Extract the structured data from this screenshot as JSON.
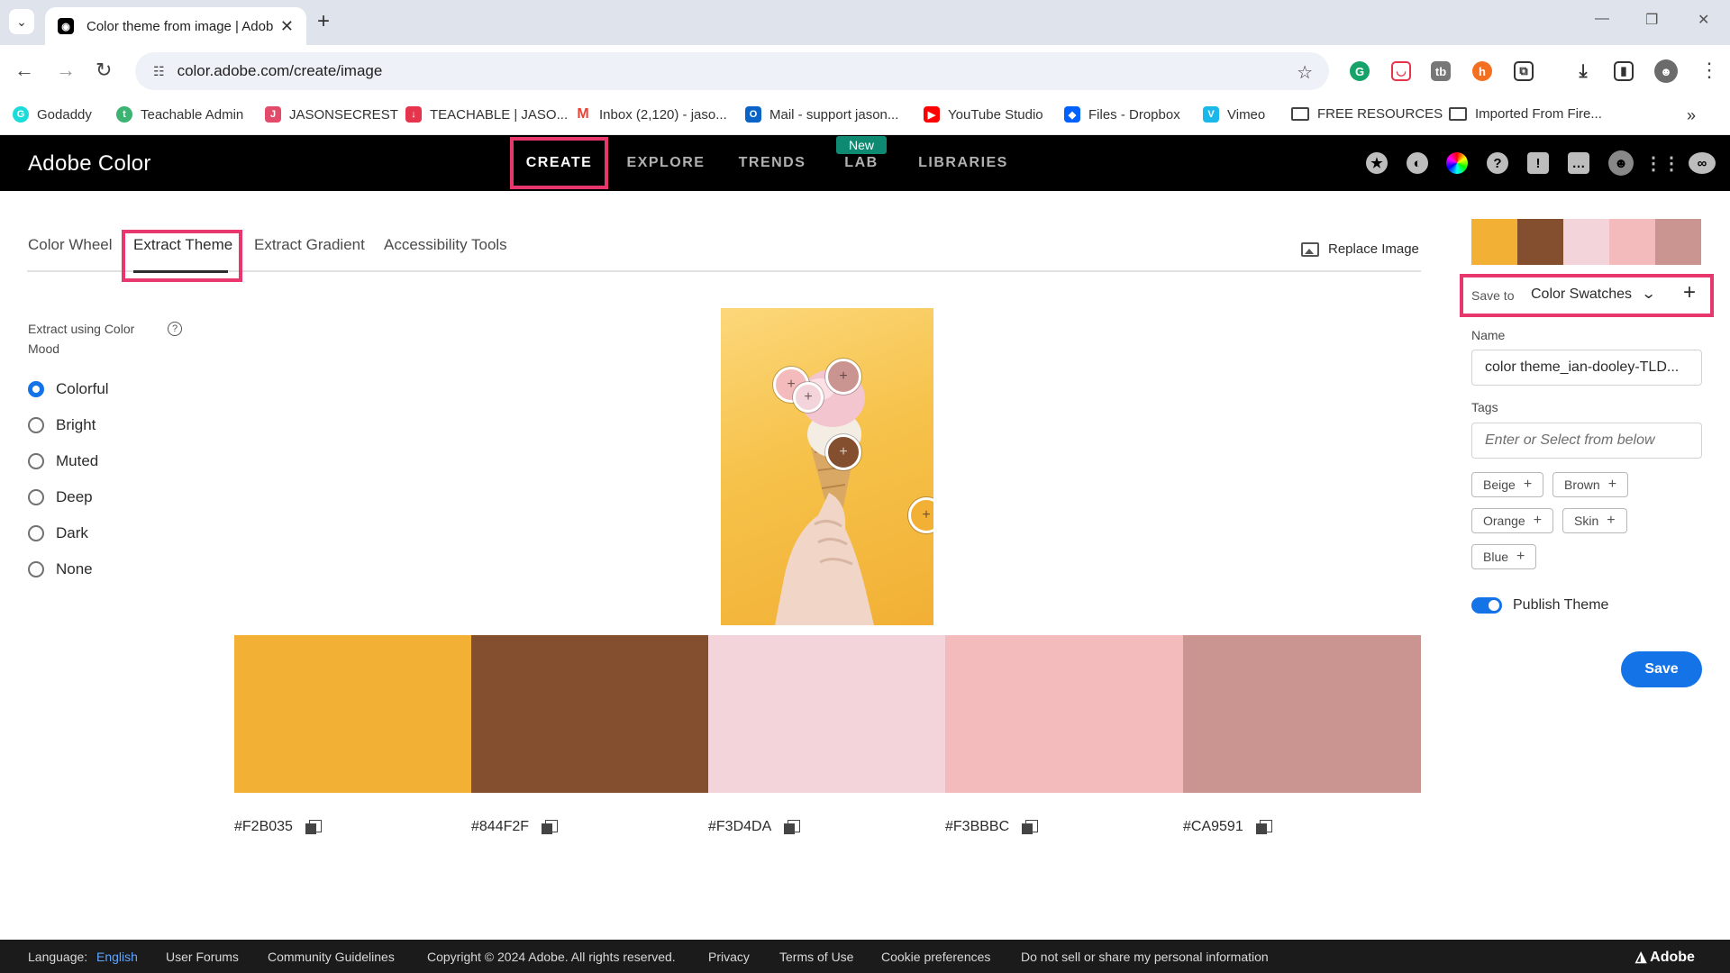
{
  "browser": {
    "tab_title": "Color theme from image | Adob",
    "url": "color.adobe.com/create/image",
    "bookmarks": [
      {
        "label": "Godaddy",
        "icon": "godaddy-icon",
        "color": "#1bdbdb"
      },
      {
        "label": "Teachable Admin",
        "icon": "teachable-icon",
        "color": "#3cb371"
      },
      {
        "label": "JASONSECREST",
        "icon": "jasonsecrest-icon",
        "color": "#e34b6a"
      },
      {
        "label": "TEACHABLE | JASO...",
        "icon": "download-icon",
        "color": "#e5344c"
      },
      {
        "label": "Inbox (2,120) - jaso...",
        "icon": "gmail-icon",
        "color": "#ea4335"
      },
      {
        "label": "Mail - support jason...",
        "icon": "outlook-icon",
        "color": "#0a64c8"
      },
      {
        "label": "YouTube Studio",
        "icon": "youtube-icon",
        "color": "#ff0000"
      },
      {
        "label": "Files - Dropbox",
        "icon": "dropbox-icon",
        "color": "#0061fe"
      },
      {
        "label": "Vimeo",
        "icon": "vimeo-icon",
        "color": "#1ab7ea"
      },
      {
        "label": "FREE RESOURCES",
        "icon": "folder-icon"
      },
      {
        "label": "Imported From Fire...",
        "icon": "folder-icon"
      }
    ]
  },
  "app": {
    "brand": "Adobe Color",
    "nav": [
      {
        "label": "CREATE",
        "active": true
      },
      {
        "label": "EXPLORE"
      },
      {
        "label": "TRENDS"
      },
      {
        "label": "LAB"
      },
      {
        "label": "LIBRARIES"
      }
    ],
    "new_badge": "New",
    "accent": "#e8376c"
  },
  "subtabs": [
    {
      "label": "Color Wheel"
    },
    {
      "label": "Extract Theme",
      "active": true
    },
    {
      "label": "Extract Gradient"
    },
    {
      "label": "Accessibility Tools"
    }
  ],
  "replace_image": "Replace Image",
  "mood": {
    "title": "Extract using Color Mood",
    "options": [
      "Colorful",
      "Bright",
      "Muted",
      "Deep",
      "Dark",
      "None"
    ],
    "selected": "Colorful"
  },
  "palette": [
    {
      "hex": "#F2B035",
      "color": "#f2b035"
    },
    {
      "hex": "#844F2F",
      "color": "#844f2f"
    },
    {
      "hex": "#F3D4DA",
      "color": "#f3d4da"
    },
    {
      "hex": "#F3BBBC",
      "color": "#f3bbbc"
    },
    {
      "hex": "#CA9591",
      "color": "#ca9591"
    }
  ],
  "panel": {
    "save_to_label": "Save to",
    "save_to_value": "Color Swatches",
    "name_label": "Name",
    "name_value": "color theme_ian-dooley-TLD...",
    "tags_label": "Tags",
    "tags_placeholder": "Enter or Select from below",
    "tags": [
      "Beige",
      "Brown",
      "Orange",
      "Skin",
      "Blue"
    ],
    "publish_label": "Publish Theme",
    "publish_on": true,
    "save_button": "Save"
  },
  "footer": {
    "language_label": "Language:",
    "language_value": "English",
    "links": [
      "User Forums",
      "Community Guidelines",
      "Copyright © 2024 Adobe. All rights reserved.",
      "Privacy",
      "Terms of Use",
      "Cookie preferences",
      "Do not sell or share my personal information"
    ],
    "logo_text": "Adobe"
  }
}
